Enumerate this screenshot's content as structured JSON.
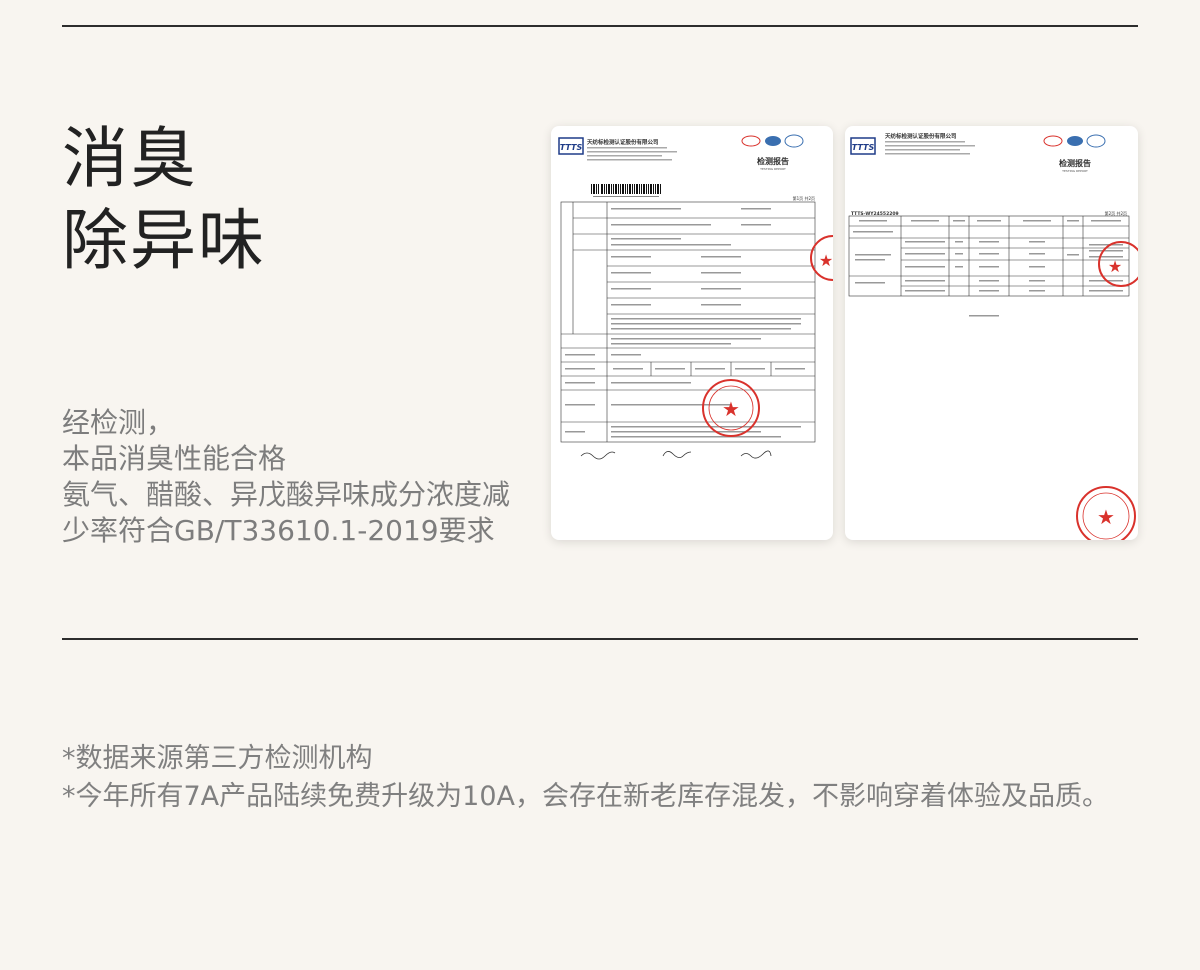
{
  "heading": {
    "line1": "消臭",
    "line2": "除异味"
  },
  "description": {
    "lines": [
      "经检测，",
      "本品消臭性能合格",
      "氨气、醋酸、异戊酸异味成分浓度减",
      "少率符合GB/T33610.1-2019要求"
    ]
  },
  "notes": {
    "line1": "*数据来源第三方检测机构",
    "line2": "*今年所有7A产品陆续免费升级为10A，会存在新老库存混发，不影响穿着体验及品质。"
  },
  "report1": {
    "company": "天纺标检测认证股份有限公司",
    "logo": "TTTS",
    "report_title": "检测报告",
    "report_subtitle": "TESTING REPORT",
    "page": "第1页 共2页"
  },
  "report2": {
    "company": "天纺标检测认证股份有限公司",
    "logo": "TTTS",
    "report_title": "检测报告",
    "report_subtitle": "TESTING REPORT",
    "report_no": "TTTS-WY24552209",
    "page": "第2页 共2页"
  },
  "colors": {
    "background": "#f8f5f0",
    "rule": "#2d2d2d",
    "heading": "#222222",
    "body_text": "#7d7d7d",
    "stamp": "#d9322c",
    "logo_blue": "#1f3c88"
  }
}
